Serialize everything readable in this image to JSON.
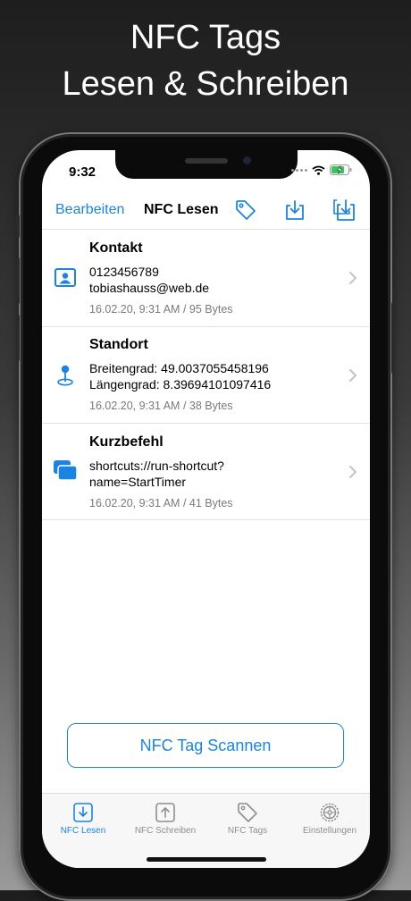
{
  "headline": {
    "line1": "NFC Tags",
    "line2": "Lesen & Schreiben"
  },
  "status_bar": {
    "time": "9:32"
  },
  "nav": {
    "edit_label": "Bearbeiten",
    "title": "NFC Lesen",
    "icons": [
      "tag-icon",
      "download-tray-icon",
      "import-stack-icon"
    ]
  },
  "records": [
    {
      "icon": "contact-card-icon",
      "title": "Kontakt",
      "lines": [
        "0123456789",
        "tobiashauss@web.de"
      ],
      "meta": "16.02.20, 9:31 AM / 95 Bytes"
    },
    {
      "icon": "location-pin-icon",
      "title": "Standort",
      "lines": [
        "Breitengrad: 49.0037055458196",
        "Längengrad: 8.39694101097416"
      ],
      "meta": "16.02.20, 9:31 AM / 38 Bytes"
    },
    {
      "icon": "shortcuts-icon",
      "title": "Kurzbefehl",
      "lines": [
        "shortcuts://run-shortcut?",
        "name=StartTimer"
      ],
      "meta": "16.02.20, 9:31 AM / 41 Bytes"
    }
  ],
  "scan_button": {
    "label": "NFC Tag Scannen"
  },
  "tabs": [
    {
      "label": "NFC Lesen",
      "icon": "download-tray-icon",
      "active": true
    },
    {
      "label": "NFC Schreiben",
      "icon": "upload-tray-icon",
      "active": false
    },
    {
      "label": "NFC Tags",
      "icon": "tag-icon",
      "active": false
    },
    {
      "label": "Einstellungen",
      "icon": "gear-icon",
      "active": false
    }
  ],
  "colors": {
    "accent": "#1a84e4",
    "battery": "#35c759"
  }
}
